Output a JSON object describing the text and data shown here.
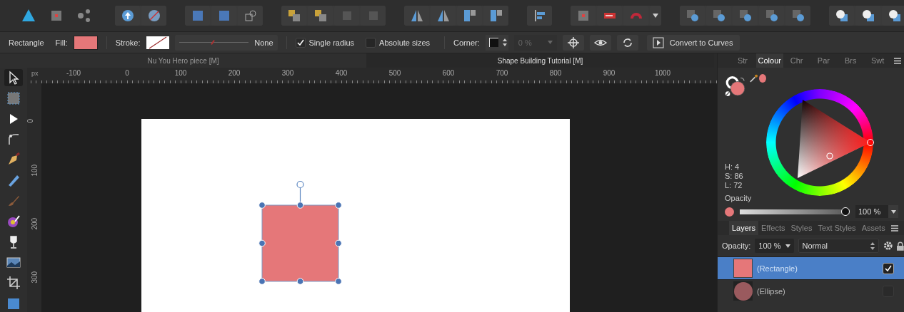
{
  "context_bar": {
    "tool_name": "Rectangle",
    "fill_label": "Fill:",
    "stroke_label": "Stroke:",
    "stroke_width": "None",
    "stroke_slider": {
      "level": 0.48
    },
    "single_radius": {
      "label": "Single radius",
      "checked": true
    },
    "absolute_sizes": {
      "label": "Absolute sizes",
      "checked": false
    },
    "corner_label": "Corner:",
    "corner_value": "0 %",
    "convert_button": "Convert to Curves"
  },
  "document_tabs": [
    {
      "title": "Nu You Hero piece [M]",
      "selected": false
    },
    {
      "title": "Shape Building Tutorial [M]",
      "selected": true
    }
  ],
  "tools": [
    {
      "kind": "move",
      "selected": true
    },
    {
      "kind": "artboard",
      "selected": false
    },
    {
      "kind": "node",
      "selected": false
    },
    {
      "kind": "corner",
      "selected": false
    },
    {
      "kind": "pen",
      "selected": false
    },
    {
      "kind": "pencil",
      "selected": false
    },
    {
      "kind": "brush",
      "selected": false
    },
    {
      "kind": "fill",
      "selected": false
    },
    {
      "kind": "transparency",
      "selected": false
    },
    {
      "kind": "place",
      "selected": false
    },
    {
      "kind": "crop",
      "selected": false
    },
    {
      "kind": "rectangle",
      "selected": false
    }
  ],
  "ruler": {
    "unit": "px",
    "horizontal": [
      "-100",
      "0",
      "100",
      "200",
      "300",
      "400",
      "500",
      "600",
      "700",
      "800",
      "900",
      "1000"
    ],
    "vertical": [
      "0",
      "100",
      "200",
      "300"
    ]
  },
  "panel_tabs": [
    {
      "label": "Str",
      "selected": false
    },
    {
      "label": "Colour",
      "selected": true
    },
    {
      "label": "Chr",
      "selected": false
    },
    {
      "label": "Par",
      "selected": false
    },
    {
      "label": "Brs",
      "selected": false
    },
    {
      "label": "Swt",
      "selected": false
    }
  ],
  "colour": {
    "hue": "H: 4",
    "saturation": "S: 86",
    "lightness": "L: 72",
    "opacity_label": "Opacity",
    "opacity": {
      "level": 1
    },
    "opacity_value": "100 %"
  },
  "layer_tabs": [
    {
      "label": "Layers",
      "selected": true
    },
    {
      "label": "Effects",
      "selected": false
    },
    {
      "label": "Styles",
      "selected": false
    },
    {
      "label": "Text Styles",
      "selected": false
    },
    {
      "label": "Assets",
      "selected": false
    }
  ],
  "layers": {
    "opacity_label": "Opacity:",
    "opacity_value": "100 %",
    "blend_mode": "Normal",
    "rows": [
      {
        "kind": "rectangle",
        "name": "(Rectangle)",
        "selected": true,
        "visible": true
      },
      {
        "kind": "ellipse",
        "name": "(Ellipse)",
        "selected": false,
        "visible": false
      }
    ]
  }
}
